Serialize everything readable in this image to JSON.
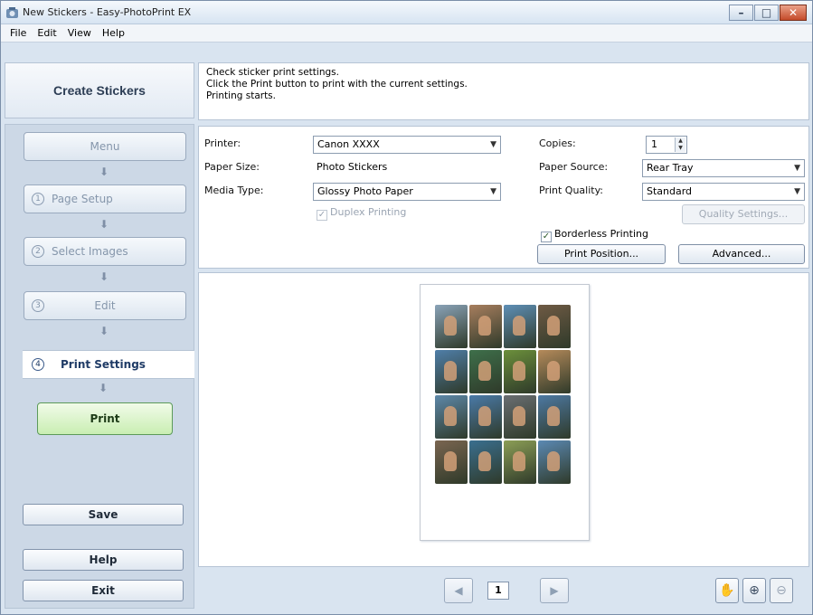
{
  "window": {
    "title": "New Stickers - Easy-PhotoPrint EX",
    "controls": [
      "minimize-icon",
      "maximize-icon",
      "close-icon"
    ]
  },
  "menu": [
    "File",
    "Edit",
    "View",
    "Help"
  ],
  "left_panel": {
    "header": "Create Stickers",
    "steps": [
      {
        "num": "",
        "label": "Menu"
      },
      {
        "num": "1",
        "label": "Page Setup"
      },
      {
        "num": "2",
        "label": "Select Images"
      },
      {
        "num": "3",
        "label": "Edit"
      },
      {
        "num": "4",
        "label": "Print Settings"
      }
    ],
    "print": "Print",
    "save": "Save",
    "help": "Help",
    "exit": "Exit"
  },
  "info": {
    "line1": "Check sticker print settings.",
    "line2": "Click the Print button to print with the current settings.",
    "line3": "Printing starts."
  },
  "settings": {
    "printer_label": "Printer:",
    "printer_value": "Canon XXXX",
    "paper_size_label": "Paper Size:",
    "paper_size_value": "Photo Stickers",
    "media_type_label": "Media Type:",
    "media_type_value": "Glossy Photo Paper",
    "duplex_label": "Duplex Printing",
    "copies_label": "Copies:",
    "copies_value": "1",
    "paper_source_label": "Paper Source:",
    "paper_source_value": "Rear Tray",
    "print_quality_label": "Print Quality:",
    "print_quality_value": "Standard",
    "quality_settings": "Quality Settings...",
    "borderless_label": "Borderless Printing",
    "print_position": "Print Position...",
    "advanced": "Advanced..."
  },
  "preview": {
    "page_number": "1",
    "photo_colors": [
      "#8aa3b8",
      "#a77e5e",
      "#5e8fb6",
      "#6f5a44",
      "#4f7ea8",
      "#3e6f4a",
      "#6b8f3b",
      "#b58a5a",
      "#5d88a9",
      "#4a7aa8",
      "#6a6e72",
      "#4d79a3",
      "#7a6550",
      "#3a6f8f",
      "#8c9e56",
      "#5b89b3"
    ]
  },
  "icons": {
    "prev": "prev-page-icon",
    "next": "next-page-icon",
    "hand": "hand-tool-icon",
    "zoom_in": "zoom-in-icon",
    "zoom_out": "zoom-out-icon"
  }
}
